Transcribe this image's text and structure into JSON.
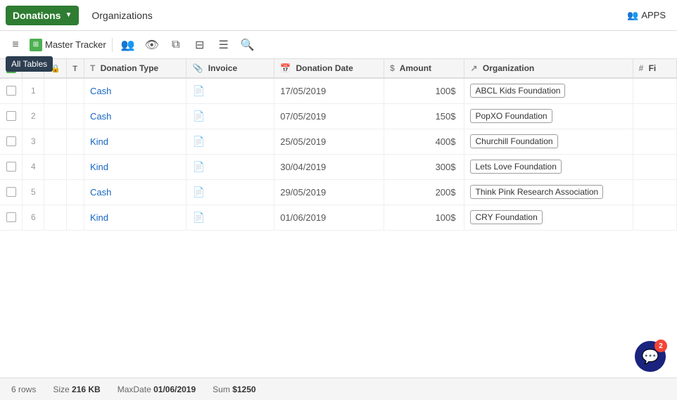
{
  "nav": {
    "dropdown_icon": "▼",
    "active_tab": "Donations",
    "tabs": [
      "Donations",
      "Organizations"
    ],
    "apps_label": "APPS",
    "apps_icon": "👥"
  },
  "toolbar": {
    "hamburger": "≡",
    "tracker_label": "Master Tracker",
    "tracker_icon": "⊞",
    "all_tables_tooltip": "All Tables",
    "icons": [
      "👥",
      "👁",
      "⧉",
      "⊟",
      "⊟",
      "🔍"
    ]
  },
  "table": {
    "columns": [
      {
        "id": "checkbox",
        "label": "",
        "icon": ""
      },
      {
        "id": "rownum",
        "label": "",
        "icon": ""
      },
      {
        "id": "lock",
        "label": "",
        "icon": "🔒"
      },
      {
        "id": "type",
        "label": "T",
        "icon": ""
      },
      {
        "id": "donation_type",
        "label": "Donation Type",
        "icon": "T"
      },
      {
        "id": "invoice",
        "label": "Invoice",
        "icon": "📎"
      },
      {
        "id": "donation_date",
        "label": "Donation Date",
        "icon": "📅"
      },
      {
        "id": "amount",
        "label": "Amount",
        "icon": "$"
      },
      {
        "id": "organization",
        "label": "Organization",
        "icon": "↗"
      },
      {
        "id": "fi",
        "label": "Fi",
        "icon": "#"
      }
    ],
    "rows": [
      {
        "num": "1",
        "donation_type": "Cash",
        "invoice": "",
        "donation_date": "17/05/2019",
        "amount": "100$",
        "organization": "ABCL Kids Foundation"
      },
      {
        "num": "2",
        "donation_type": "Cash",
        "invoice": "",
        "donation_date": "07/05/2019",
        "amount": "150$",
        "organization": "PopXO Foundation"
      },
      {
        "num": "3",
        "donation_type": "Kind",
        "invoice": "",
        "donation_date": "25/05/2019",
        "amount": "400$",
        "organization": "Churchill Foundation"
      },
      {
        "num": "4",
        "donation_type": "Kind",
        "invoice": "",
        "donation_date": "30/04/2019",
        "amount": "300$",
        "organization": "Lets Love Foundation"
      },
      {
        "num": "5",
        "donation_type": "Cash",
        "invoice": "",
        "donation_date": "29/05/2019",
        "amount": "200$",
        "organization": "Think Pink Research Association"
      },
      {
        "num": "6",
        "donation_type": "Kind",
        "invoice": "",
        "donation_date": "01/06/2019",
        "amount": "100$",
        "organization": "CRY Foundation"
      }
    ]
  },
  "status_bar": {
    "rows_label": "6 rows",
    "size_label": "Size",
    "size_value": "216 KB",
    "maxdate_label": "MaxDate",
    "maxdate_value": "01/06/2019",
    "sum_label": "Sum",
    "sum_value": "$1250"
  },
  "chat": {
    "badge": "2"
  }
}
